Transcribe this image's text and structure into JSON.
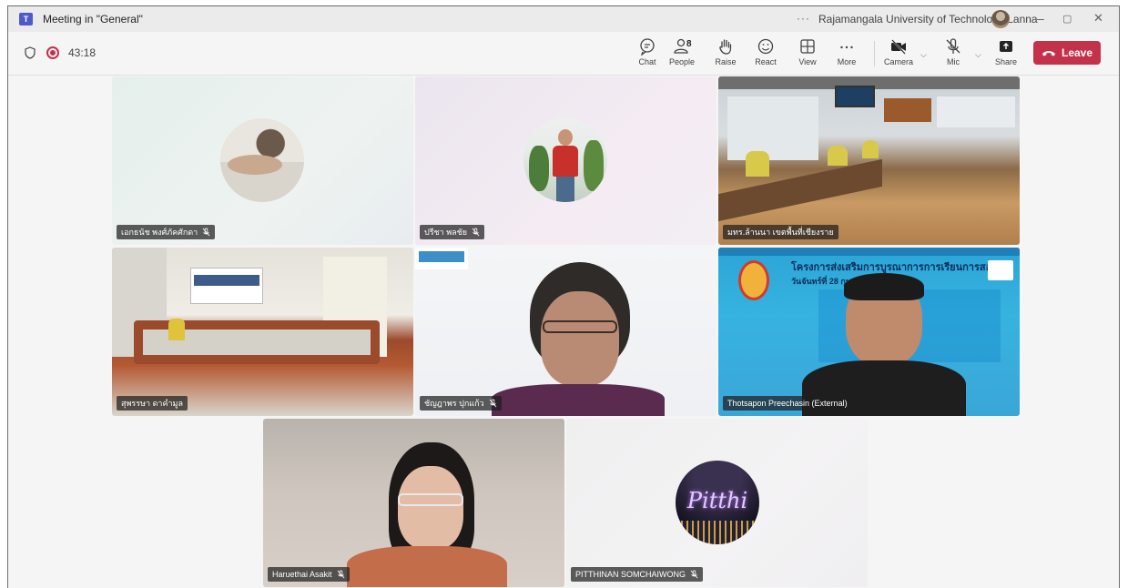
{
  "window": {
    "title": "Meeting in \"General\"",
    "more": "···",
    "organization": "Rajamangala University of Technology Lanna",
    "controls": {
      "minimize": "–",
      "restore": "▢",
      "close": "✕"
    }
  },
  "toolbar": {
    "timer": "43:18",
    "buttons": {
      "chat": "Chat",
      "people": "People",
      "people_count": "8",
      "raise": "Raise",
      "react": "React",
      "view": "View",
      "more": "More",
      "camera": "Camera",
      "mic": "Mic",
      "share": "Share"
    },
    "leave": "Leave",
    "accent": "#c4314b"
  },
  "participants": [
    {
      "name": "เอกธนัช พงศ์ภัคศักดา",
      "muted": true
    },
    {
      "name": "ปรีชา พลชัย",
      "muted": true
    },
    {
      "name": "มทร.ล้านนา เขตพื้นที่เชียงราย",
      "muted": false
    },
    {
      "name": "สุพรรษา ดาคำมูล",
      "muted": false
    },
    {
      "name": "ชัญฎาพร ปุกแก้ว",
      "muted": true
    },
    {
      "name": "Thotsapon Preechasin (External)",
      "muted": false
    },
    {
      "name": "Haruethai Asakit",
      "muted": true
    },
    {
      "name": "PITTHINAN SOMCHAIWONG",
      "muted": true
    }
  ],
  "banner": {
    "title": "โครงการส่งเสริมการบูรณาการการเรียนการสอน",
    "date": "วันจันทร์ที่ 28 กุมภาพันธ์"
  },
  "avatar_text": {
    "pitthinan": "Pitthi"
  }
}
